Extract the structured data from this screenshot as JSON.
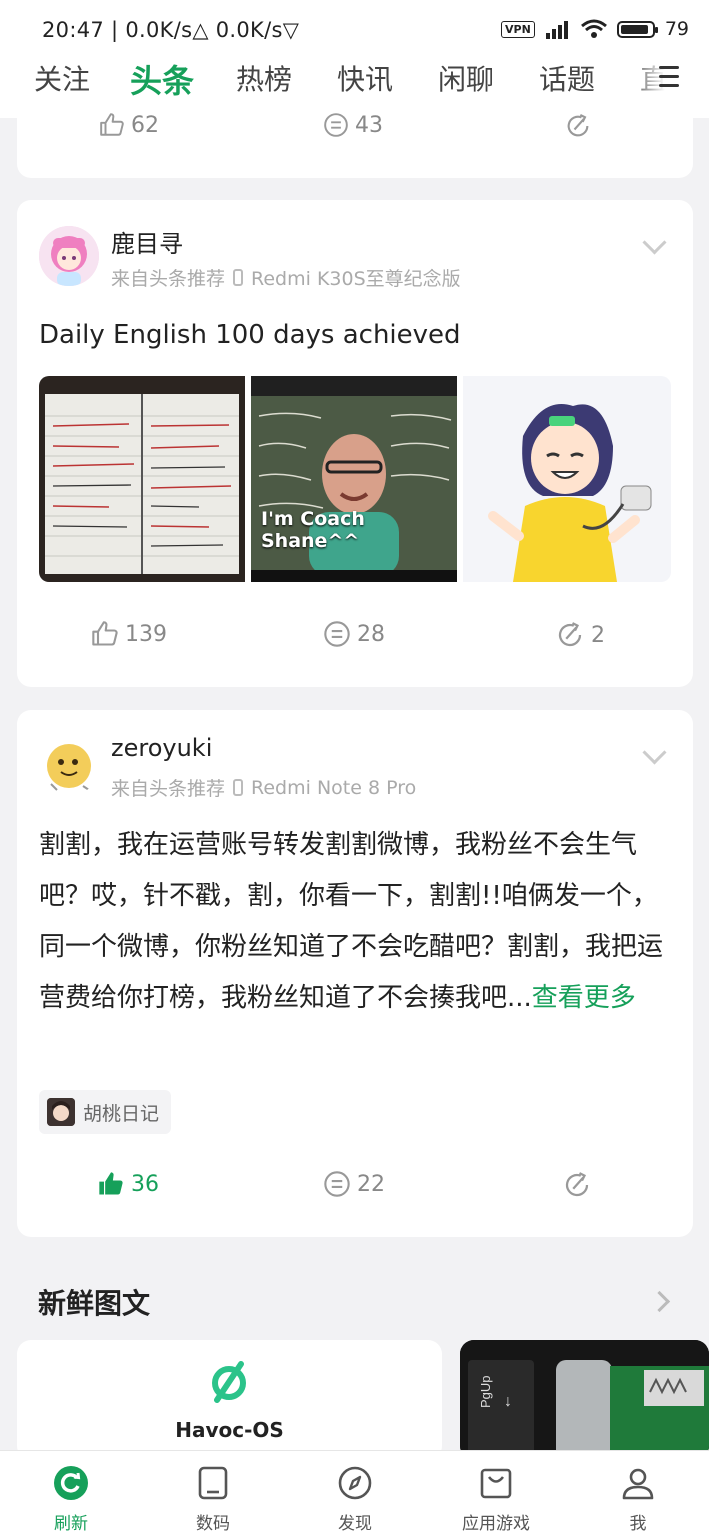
{
  "status_bar": {
    "time_speed": "20:47 | 0.0K/s△  0.0K/s▽",
    "vpn": "VPN",
    "battery": "79"
  },
  "top_tabs": [
    "关注",
    "头条",
    "热榜",
    "快讯",
    "闲聊",
    "话题",
    "直"
  ],
  "active_tab": "头条",
  "card0": {
    "likes": "62",
    "comments": "43"
  },
  "card1": {
    "username": "鹿目寻",
    "source": "来自头条推荐",
    "device": "Redmi K30S至尊纪念版",
    "title": "Daily English 100 days achieved",
    "thumb_caption": "I'm Coach Shane^^",
    "likes": "139",
    "comments": "28",
    "shares": "2"
  },
  "card2": {
    "username": "zeroyuki",
    "source": "来自头条推荐",
    "device": "Redmi Note 8 Pro",
    "text": "割割，我在运营账号转发割割微博，我粉丝不会生气吧？哎，针不戳，割，你看一下，割割!!咱俩发一个，同一个微博，你粉丝知道了不会吃醋吧？割割，我把运营费给你打榜，我粉丝知道了不会揍我吧...",
    "more": "查看更多",
    "topic": "胡桃日记",
    "likes": "36",
    "comments": "22"
  },
  "section": {
    "title": "新鲜图文"
  },
  "tiles": {
    "left_name": "Havoc-OS"
  },
  "bottom_nav": [
    "刷新",
    "数码",
    "发现",
    "应用游戏",
    "我"
  ],
  "colors": {
    "accent": "#16a05a",
    "background": "#f2f2f4",
    "muted": "#888888"
  }
}
